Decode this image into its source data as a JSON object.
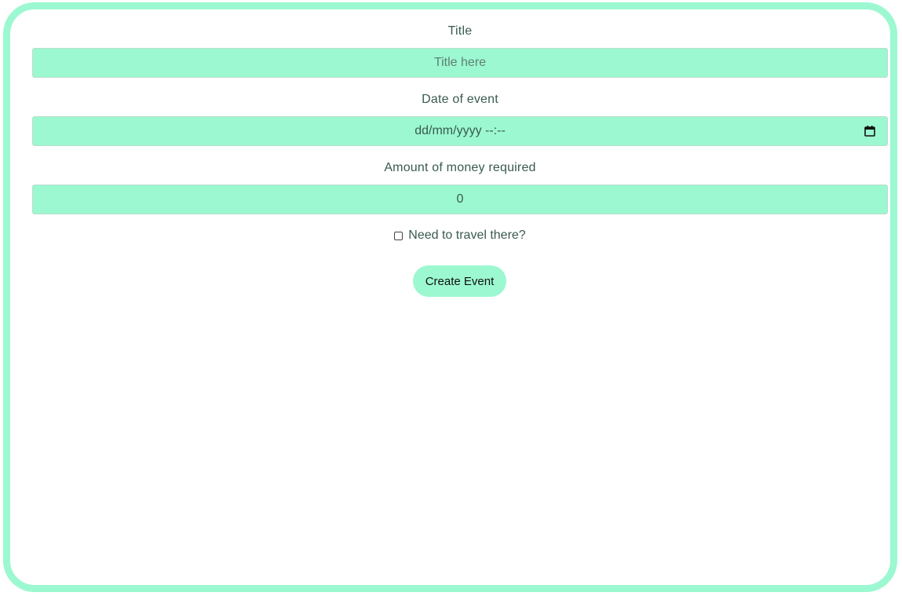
{
  "form": {
    "title_label": "Title",
    "title_placeholder": "Title here",
    "date_label": "Date of event",
    "date_value": "dd/mm/yyyy --:--",
    "money_label": "Amount of money required",
    "money_value": "0",
    "travel_label": "Need to travel there?",
    "travel_checked": false,
    "submit_label": "Create Event"
  },
  "colors": {
    "accent": "#9cf8d0",
    "text": "#3a5a50"
  },
  "icons": {
    "date_picker": "calendar-icon"
  }
}
